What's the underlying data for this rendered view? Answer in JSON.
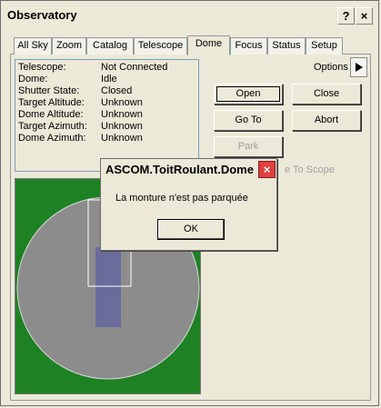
{
  "window": {
    "title": "Observatory",
    "help_glyph": "?",
    "close_glyph": "×"
  },
  "tabs": [
    {
      "label": "All Sky"
    },
    {
      "label": "Zoom"
    },
    {
      "label": "Catalog"
    },
    {
      "label": "Telescope"
    },
    {
      "label": "Dome",
      "active": true
    },
    {
      "label": "Focus"
    },
    {
      "label": "Status"
    },
    {
      "label": "Setup"
    }
  ],
  "status": [
    {
      "label": "Telescope:",
      "value": "Not Connected"
    },
    {
      "label": "Dome:",
      "value": "Idle"
    },
    {
      "label": "Shutter State:",
      "value": "Closed"
    },
    {
      "label": "Target Altitude:",
      "value": "Unknown"
    },
    {
      "label": "Dome Altitude:",
      "value": "Unknown"
    },
    {
      "label": "Target Azimuth:",
      "value": "Unknown"
    },
    {
      "label": "Dome Azimuth:",
      "value": "Unknown"
    }
  ],
  "options": {
    "label": "Options",
    "arrow_icon": "triangle-right-icon"
  },
  "buttons": {
    "open": "Open",
    "close": "Close",
    "goto": "Go To",
    "abort": "Abort",
    "park": "Park",
    "slave_hint": "e To Scope"
  },
  "dialog": {
    "title": "ASCOM.ToitRoulant.Dome",
    "message": "La monture n'est pas parquée",
    "ok": "OK",
    "close_glyph": "×"
  },
  "colors": {
    "sky_background": "#1e8224",
    "dome_circle": "#8c8c8c",
    "slit": "#6b6b9c",
    "window_frame": "#ffffff"
  }
}
